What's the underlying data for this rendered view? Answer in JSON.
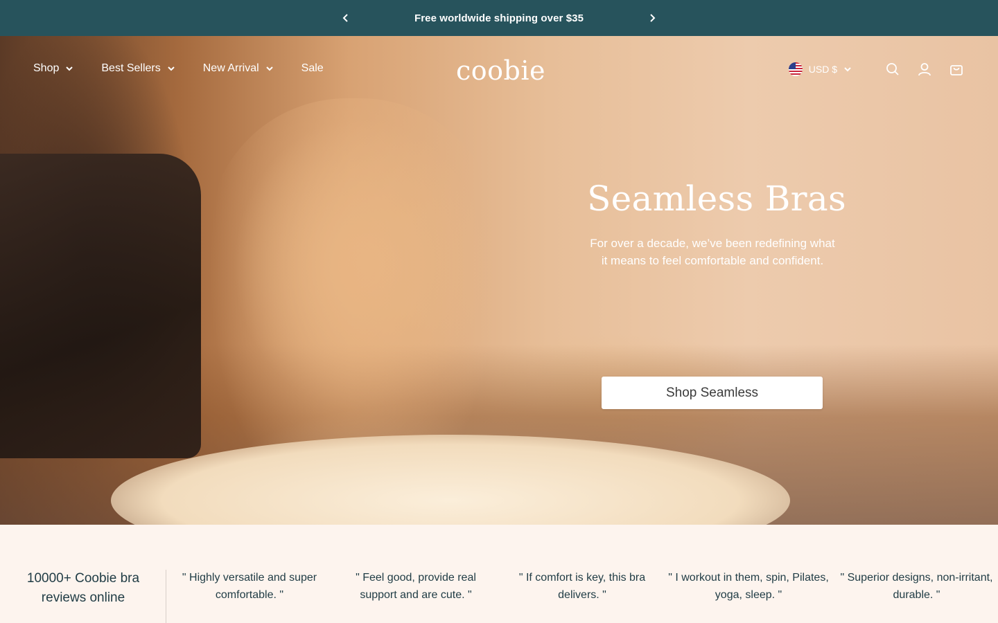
{
  "announcement": {
    "message": "Free worldwide shipping over $35",
    "prev_icon": "chevron-left-icon",
    "next_icon": "chevron-right-icon"
  },
  "header": {
    "nav": [
      {
        "label": "Shop",
        "has_dropdown": true
      },
      {
        "label": "Best Sellers",
        "has_dropdown": true
      },
      {
        "label": "New Arrival",
        "has_dropdown": true
      },
      {
        "label": "Sale",
        "has_dropdown": false
      }
    ],
    "logo": "coobie",
    "currency": "USD $",
    "icons": [
      "search-icon",
      "account-icon",
      "cart-icon"
    ]
  },
  "hero": {
    "title": "Seamless Bras",
    "subtitle_line1": "For over a decade, we’ve been redefining what",
    "subtitle_line2": "it means to feel comfortable and confident.",
    "cta": "Shop Seamless"
  },
  "reviews": {
    "stat_line1": "10000+ Coobie bra",
    "stat_line2": "reviews online",
    "quotes": [
      {
        "line1": "\" Highly versatile and super",
        "line2": "comfortable. \""
      },
      {
        "line1": "\" Feel good, provide real",
        "line2": "support and are cute. \""
      },
      {
        "line1": "\" If comfort is key, this bra",
        "line2": "delivers. \""
      },
      {
        "line1": "\" I workout in them, spin, Pilates,",
        "line2": "yoga, sleep. \""
      },
      {
        "line1": "\" Superior designs, non-irritant,",
        "line2": "durable. \""
      }
    ]
  },
  "colors": {
    "announcement_bg": "#27535c",
    "text_dark": "#1f3b44",
    "strip_bg": "#fdf4ee"
  }
}
